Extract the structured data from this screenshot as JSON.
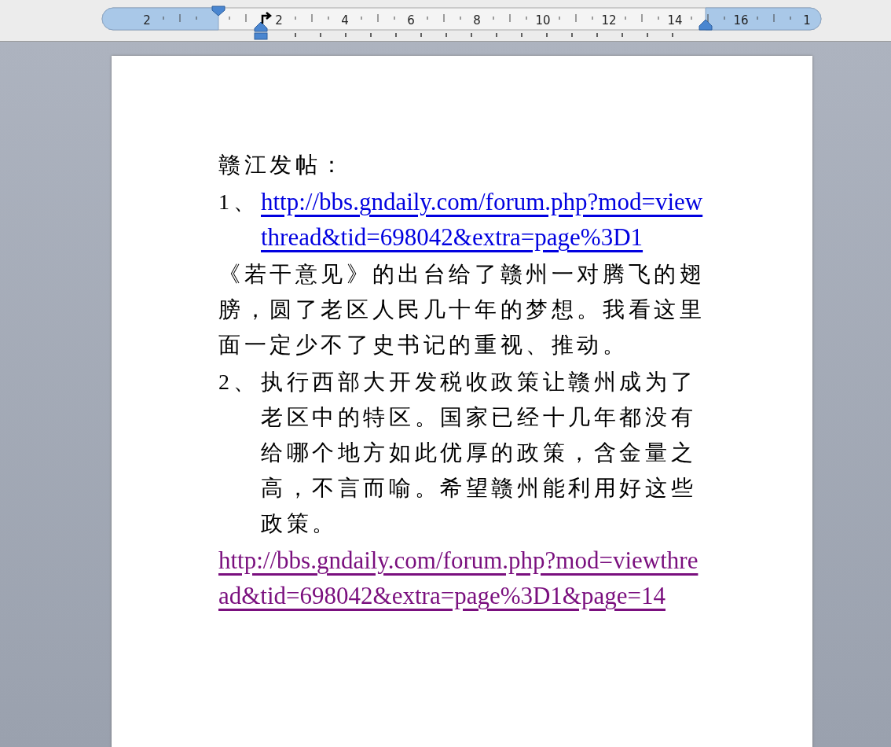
{
  "ruler": {
    "labels": [
      "2",
      "2",
      "4",
      "6",
      "8",
      "10",
      "12",
      "14",
      "16",
      "1"
    ]
  },
  "document": {
    "heading": "赣江发帖：",
    "blocks": [
      {
        "kind": "link-item",
        "number": "1、",
        "text": "http://bbs.gndaily.com/forum.php?mod=viewthread&tid=698042&extra=page%3D1",
        "visited": false
      },
      {
        "kind": "paragraph",
        "text": "《若干意见》的出台给了赣州一对腾飞的翅膀，圆了老区人民几十年的梦想。我看这里面一定少不了史书记的重视、推动。"
      },
      {
        "kind": "text-item",
        "number": "2、",
        "text": "执行西部大开发税收政策让赣州成为了老区中的特区。国家已经十几年都没有给哪个地方如此优厚的政策，含金量之高，不言而喻。希望赣州能利用好这些政策。"
      },
      {
        "kind": "link",
        "text": "http://bbs.gndaily.com/forum.php?mod=viewthread&tid=698042&extra=page%3D1&page=14",
        "visited": true
      }
    ]
  }
}
